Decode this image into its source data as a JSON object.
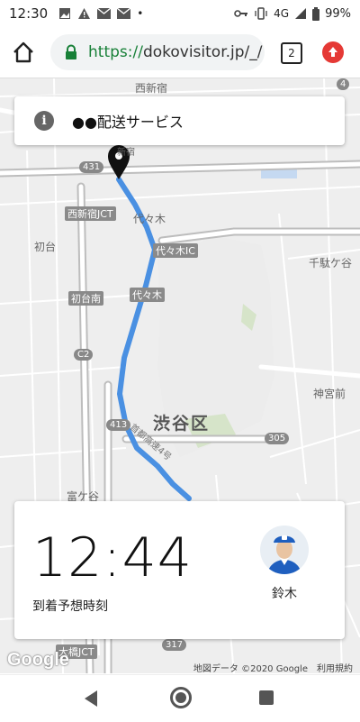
{
  "status_bar": {
    "time": "12:30",
    "dot": "•",
    "network": "4G",
    "battery": "99%",
    "icons": [
      "image-icon",
      "warning-icon",
      "mail-icon",
      "mail-icon",
      "key-icon",
      "vibrate-icon",
      "signal-icon",
      "battery-icon"
    ]
  },
  "browser": {
    "url_scheme": "https://",
    "url_rest": "dokovisitor.jp/_/",
    "tab_count": "2"
  },
  "header_card": {
    "title": "●●配送サービス",
    "info_symbol": "i"
  },
  "map": {
    "labels": {
      "nishishinjuku": "西新宿",
      "shinjuku": "新宿",
      "nishishinjuku_jct": "西新宿JCT",
      "yoyogi": "代々木",
      "hatsudai": "初台",
      "yoyogi_ic": "代々木IC",
      "sendagaya": "千駄ケ谷",
      "hatsudai_minami": "初台南",
      "yoyogi2": "代々木",
      "jingumae": "神宮前",
      "shibuya_ku": "渋谷区",
      "tomigaya": "富ケ谷",
      "ohashi_jct": "大橋JCT",
      "c2": "C2",
      "r431": "431",
      "r413": "413",
      "r305": "305",
      "r317": "317",
      "r4": "4",
      "highway": "首都高速4号"
    },
    "google_logo": "Google",
    "attribution": "地図データ ©2020 Google",
    "terms": "利用規約"
  },
  "eta_card": {
    "time": "12:44",
    "label": "到着予想時刻",
    "driver_name": "鈴木"
  },
  "colors": {
    "route": "#4a90e2",
    "park": "#d6e4c9",
    "road": "#ffffff",
    "accent_red": "#e53935",
    "lock_green": "#188038"
  }
}
